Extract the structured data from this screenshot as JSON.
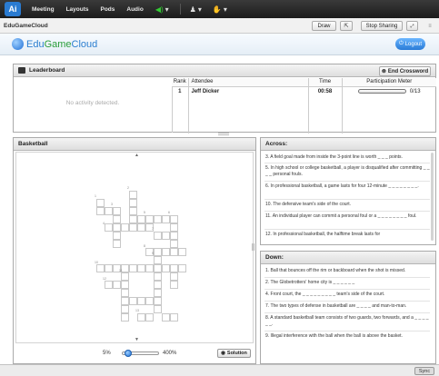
{
  "menubar": {
    "logo_glyph": "Ai",
    "items": [
      "Meeting",
      "Layouts",
      "Pods",
      "Audio"
    ]
  },
  "window": {
    "title": "EduGameCloud",
    "draw_label": "Draw",
    "stop_sharing_label": "Stop Sharing"
  },
  "banner": {
    "brand_part1": "Edu",
    "brand_part2": "Game",
    "brand_part3": "Cloud",
    "logout_label": "Logout"
  },
  "leaderboard": {
    "title": "Leaderboard",
    "end_button_label": "End Crossword",
    "no_activity": "No activity detected.",
    "columns": [
      "Rank",
      "Attendee",
      "Time",
      "Participation Meter"
    ],
    "rows": [
      {
        "rank": "1",
        "attendee": "Jeff Dicker",
        "time": "00:58",
        "meter_fraction": 0.0,
        "meter_text": "0/13"
      }
    ]
  },
  "basketball": {
    "title": "Basketball",
    "clue_numbers": [
      "1",
      "2",
      "3",
      "4",
      "5",
      "6",
      "7",
      "8",
      "9",
      "10",
      "11",
      "12",
      "13"
    ],
    "zoom_min": "5%",
    "zoom_max": "400%",
    "zoom_fraction": 0.1,
    "solution_label": "Solution"
  },
  "across": {
    "title": "Across:",
    "clues": [
      "3. A field goal made from inside the 3-point line is worth _ _ _ points.",
      "5. In high school or college basketball, a player is disqualified after committing _ _ _ _ personal fouls.",
      "6. In professional basketball, a game lasts for four 12-minute _ _ _ _ _ _ _ _.",
      "10. The defensive team's side of the court.",
      "11. An individual player can commit a personal foul or a _ _ _ _ _ _ _ _ foul.",
      "12. In professional basketball, the halftime break lasts for"
    ]
  },
  "down": {
    "title": "Down:",
    "clues": [
      "1. Ball that bounces off the rim or backboard when the shot is missed.",
      "2. The Globetrotters' home city is _ _ _ _ _ _",
      "4. Front court, the _ _ _ _ _ _ _ _ _ team's side of the court.",
      "7. The two types of defense in basketball are _ _ _ _ and man-to-man.",
      "8. A standard basketball team consists of two guards, two forwards, and a _ _ _ _ _ _.",
      "9. Illegal interference with the ball when the ball is above the basket."
    ]
  },
  "footer": {
    "sync_label": "Sync"
  }
}
